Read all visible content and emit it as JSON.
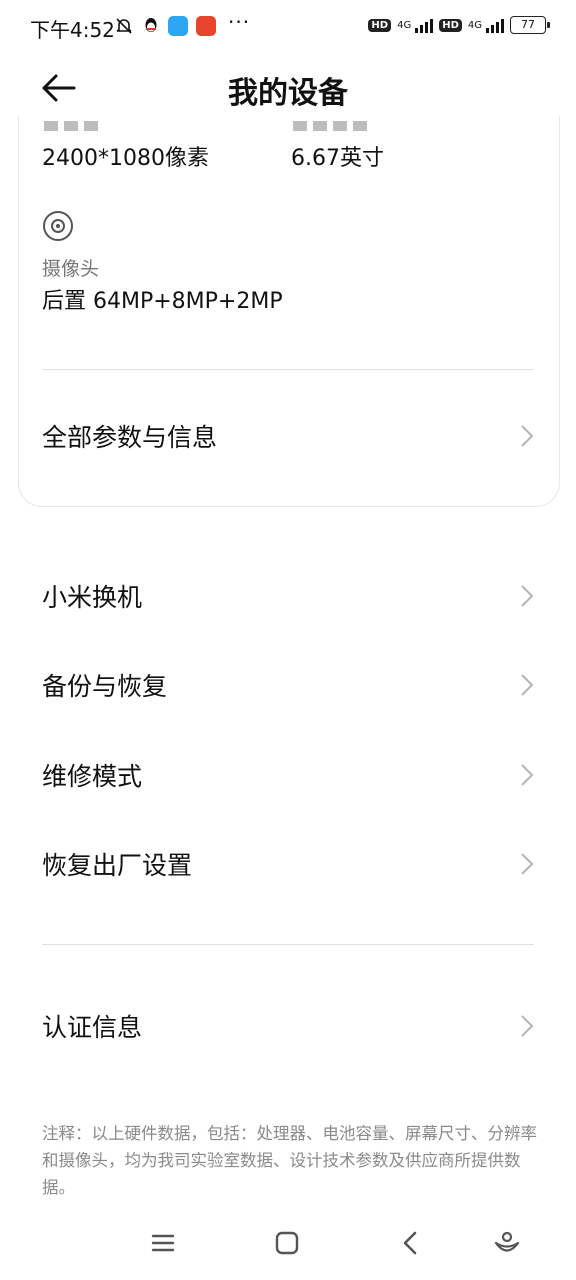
{
  "status_bar": {
    "time": "下午4:52",
    "more": "···",
    "hd1": "HD",
    "net1": "4G",
    "hd2": "HD",
    "net2": "4G",
    "battery": "77"
  },
  "header": {
    "title": "我的设备"
  },
  "specs": {
    "resolution_value": "2400*1080像素",
    "screen_size_value": "6.67英寸",
    "camera_label": "摄像头",
    "camera_value": "后置 64MP+8MP+2MP"
  },
  "card_link": {
    "label": "全部参数与信息"
  },
  "menu": {
    "items": [
      {
        "label": "小米换机"
      },
      {
        "label": "备份与恢复"
      },
      {
        "label": "维修模式"
      },
      {
        "label": "恢复出厂设置"
      }
    ],
    "certification": "认证信息"
  },
  "note": "注释：以上硬件数据，包括：处理器、电池容量、屏幕尺寸、分辨率和摄像头，均为我司实验室数据、设计技术参数及供应商所提供数据。",
  "icons": {
    "back": "back-arrow-icon",
    "camera": "camera-lens-icon",
    "chevron": "chevron-right-icon",
    "nav_menu": "menu-icon",
    "nav_home": "home-icon",
    "nav_back": "back-icon",
    "nav_assistant": "assistant-icon"
  },
  "colors": {
    "text_primary": "#111111",
    "text_secondary": "#8a8a8a",
    "divider": "#e0e0e0",
    "chevron": "#b5b5b5"
  }
}
